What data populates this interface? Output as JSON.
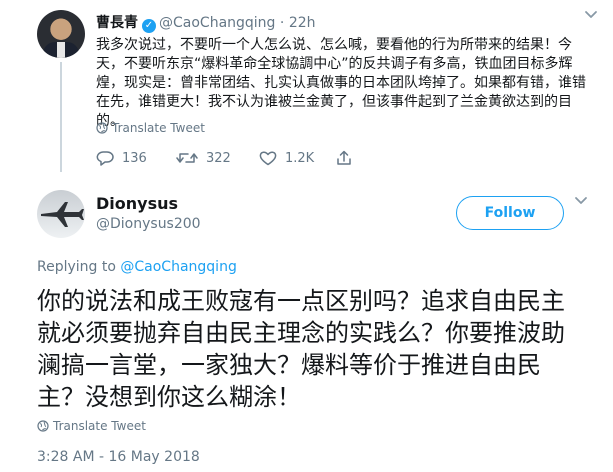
{
  "parent_tweet": {
    "author_name": "曹長青",
    "author_handle": "@CaoChangqing",
    "separator": "·",
    "time": "22h",
    "text": "我多次说过，不要听一个人怎么说、怎么喊，要看他的行为所带来的结果！今天，不要听东京“爆料革命全球協調中心”的反共调子有多高，铁血团目标多辉煌，现实是：曾非常团结、扎实认真做事的日本团队垮掉了。如果都有错，谁错在先，谁错更大！我不认为谁被兰金黄了，但该事件起到了兰金黄欲达到的目的。",
    "translate_label": "Translate Tweet",
    "reply_count": "136",
    "retweet_count": "322",
    "like_count": "1.2K"
  },
  "main_tweet": {
    "author_name": "Dionysus",
    "author_handle": "@Dionysus200",
    "follow_label": "Follow",
    "replying_prefix": "Replying to",
    "replying_to": "@CaoChangqing",
    "text": "你的说法和成王败寇有一点区别吗？追求自由民主就必须要抛弃自由民主理念的实践么？你要推波助澜搞一言堂，一家独大？爆料等价于推进自由民主？没想到你这么糊涂！",
    "translate_label": "Translate Tweet",
    "timestamp": "3:28 AM - 16 May 2018"
  },
  "colors": {
    "accent": "#1da1f2",
    "muted": "#657786",
    "text": "#14171a"
  },
  "icons": [
    "verified-icon",
    "chevron-down-icon",
    "globe-icon",
    "reply-icon",
    "retweet-icon",
    "like-icon",
    "airplane-avatar-icon"
  ]
}
